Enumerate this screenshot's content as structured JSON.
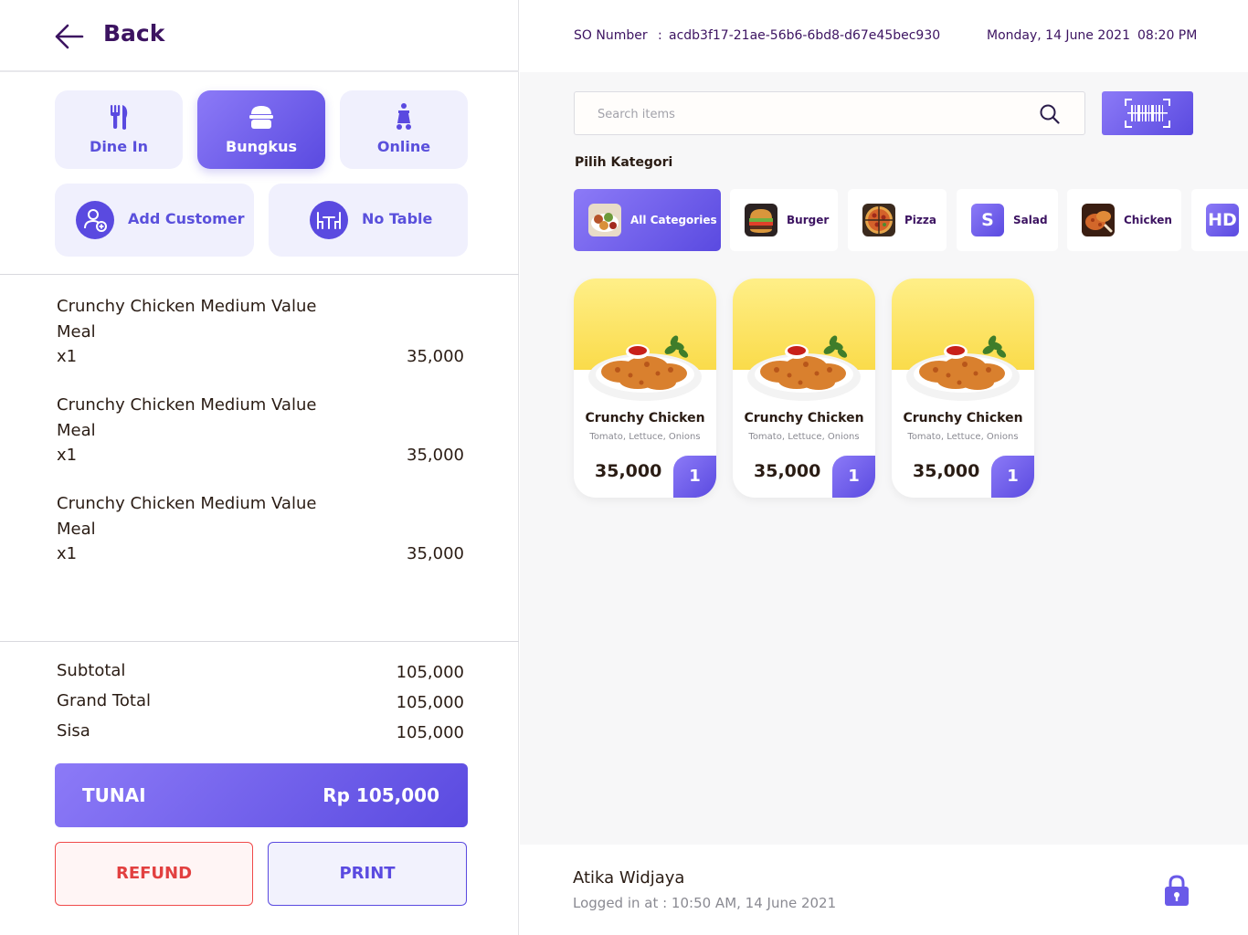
{
  "header": {
    "back_label": "Back"
  },
  "order_types": [
    {
      "label": "Dine In",
      "icon": "utensils-icon",
      "active": false
    },
    {
      "label": "Bungkus",
      "icon": "takeaway-box-icon",
      "active": true
    },
    {
      "label": "Online",
      "icon": "delivery-scooter-icon",
      "active": false
    }
  ],
  "actions": {
    "add_customer": "Add Customer",
    "no_table": "No Table"
  },
  "order_items": [
    {
      "name": "Crunchy Chicken Medium Value Meal",
      "qty": "x1",
      "price": "35,000"
    },
    {
      "name": "Crunchy Chicken Medium Value Meal",
      "qty": "x1",
      "price": "35,000"
    },
    {
      "name": "Crunchy Chicken Medium Value Meal",
      "qty": "x1",
      "price": "35,000"
    }
  ],
  "totals": {
    "subtotal_label": "Subtotal",
    "subtotal": "105,000",
    "grand_total_label": "Grand Total",
    "grand_total": "105,000",
    "sisa_label": "Sisa",
    "sisa": "105,000"
  },
  "payment": {
    "method": "TUNAI",
    "amount": "Rp 105,000"
  },
  "buttons": {
    "refund": "REFUND",
    "print": "PRINT"
  },
  "topbar": {
    "so_label": "SO Number",
    "so_colon": ":",
    "so_number": "acdb3f17-21ae-56b6-6bd8-d67e45bec930",
    "date": "Monday, 14 June 2021",
    "time": "08:20 PM"
  },
  "search": {
    "placeholder": "Search items"
  },
  "categories_title": "Pilih Kategori",
  "categories": [
    {
      "label": "All Categories",
      "icon": "mixed-food-thumb",
      "active": true
    },
    {
      "label": "Burger",
      "icon": "burger-thumb",
      "active": false
    },
    {
      "label": "Pizza",
      "icon": "pizza-thumb",
      "active": false
    },
    {
      "label": "Salad",
      "letter": "S",
      "active": false
    },
    {
      "label": "Chicken",
      "icon": "chicken-thumb",
      "active": false
    },
    {
      "letter": "HD",
      "active": false
    }
  ],
  "products": [
    {
      "name": "Crunchy Chicken",
      "description": "Tomato, Lettuce, Onions",
      "price": "35,000",
      "count": "1"
    },
    {
      "name": "Crunchy Chicken",
      "description": "Tomato, Lettuce, Onions",
      "price": "35,000",
      "count": "1"
    },
    {
      "name": "Crunchy Chicken",
      "description": "Tomato, Lettuce, Onions",
      "price": "35,000",
      "count": "1"
    }
  ],
  "user": {
    "name": "Atika Widjaya",
    "login_info": "Logged in at : 10:50 AM,  14 June 2021"
  },
  "colors": {
    "accent": "#5a4ae0",
    "accent_light": "#8c7af7",
    "brand_dark": "#3c1361",
    "danger": "#e24040",
    "card_top": "#fadb4a"
  }
}
